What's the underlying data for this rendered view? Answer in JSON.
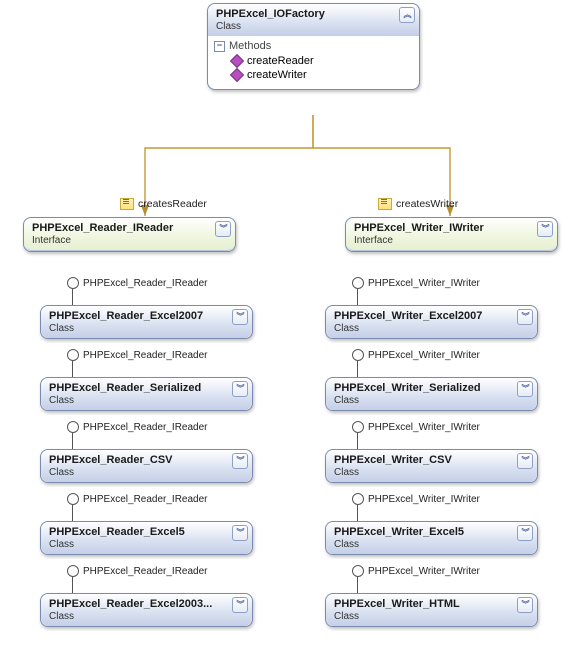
{
  "factory": {
    "title": "PHPExcel_IOFactory",
    "stereo": "Class",
    "methods_label": "Methods",
    "methods": [
      "createReader",
      "createWriter"
    ]
  },
  "rel": {
    "createsReader": "createsReader",
    "createsWriter": "createsWriter"
  },
  "reader_interface": {
    "title": "PHPExcel_Reader_IReader",
    "stereo": "Interface",
    "implements_label": "PHPExcel_Reader_IReader"
  },
  "writer_interface": {
    "title": "PHPExcel_Writer_IWriter",
    "stereo": "Interface",
    "implements_label": "PHPExcel_Writer_IWriter"
  },
  "readers": [
    {
      "title": "PHPExcel_Reader_Excel2007",
      "stereo": "Class"
    },
    {
      "title": "PHPExcel_Reader_Serialized",
      "stereo": "Class"
    },
    {
      "title": "PHPExcel_Reader_CSV",
      "stereo": "Class"
    },
    {
      "title": "PHPExcel_Reader_Excel5",
      "stereo": "Class"
    },
    {
      "title": "PHPExcel_Reader_Excel2003...",
      "stereo": "Class"
    }
  ],
  "writers": [
    {
      "title": "PHPExcel_Writer_Excel2007",
      "stereo": "Class"
    },
    {
      "title": "PHPExcel_Writer_Serialized",
      "stereo": "Class"
    },
    {
      "title": "PHPExcel_Writer_CSV",
      "stereo": "Class"
    },
    {
      "title": "PHPExcel_Writer_Excel5",
      "stereo": "Class"
    },
    {
      "title": "PHPExcel_Writer_HTML",
      "stereo": "Class"
    }
  ]
}
